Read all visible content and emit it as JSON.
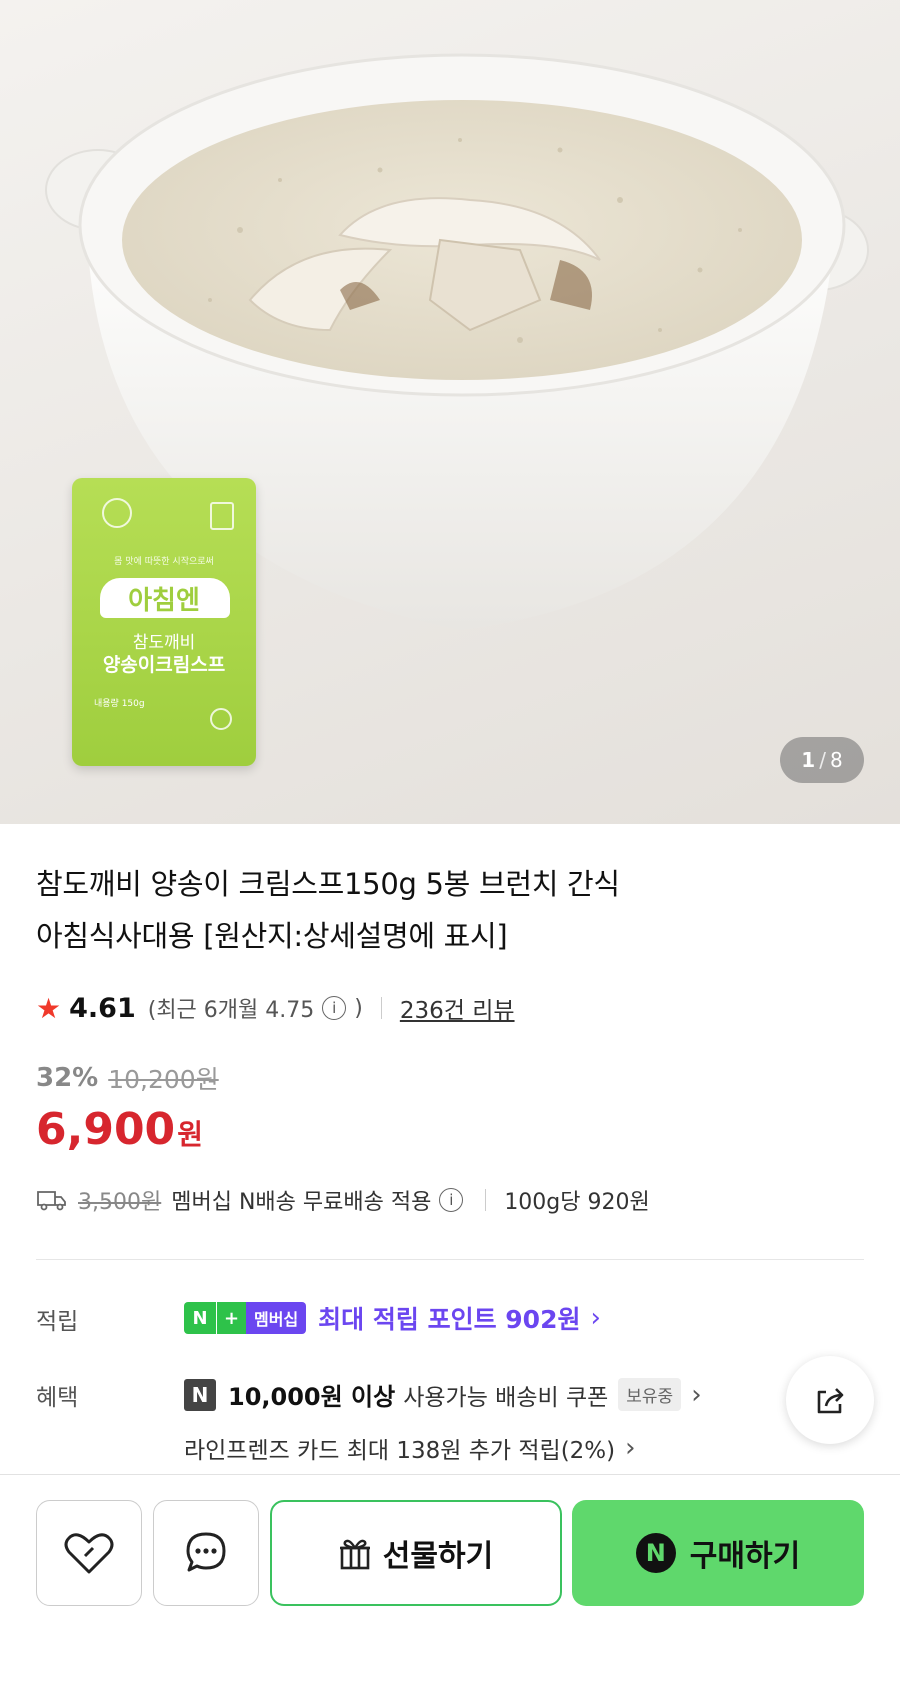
{
  "hero": {
    "image_index": "1",
    "image_separator": "/",
    "image_total": "8",
    "package": {
      "tagline": "몸 맛에 따뜻한 시작으로써",
      "brand": "아침엔",
      "line1": "참도깨비",
      "line2": "양송이크림스프",
      "weight_label": "내용량 150g"
    }
  },
  "product": {
    "title_line1": "참도깨비 양송이 크림스프150g 5봉 브런치 간식",
    "title_line2": "아침식사대용 [원산지:상세설명에 표시]",
    "rating": "4.61",
    "recent_rating_prefix": "(최근 6개월 4.75",
    "recent_rating_suffix": ")",
    "review_link": "236건 리뷰",
    "discount": "32%",
    "original_price": "10,200원",
    "price": "6,900",
    "price_unit": "원"
  },
  "shipping": {
    "original_fee": "3,500원",
    "text": "멤버십 N배송 무료배송 적용",
    "unit_price": "100g당 920원"
  },
  "benefits": {
    "points_label": "적립",
    "badge_n": "N",
    "badge_plus": "+",
    "badge_membership": "멤버십",
    "points_text": "최대 적립 포인트 902원",
    "benefit_label": "혜택",
    "coupon_badge": "N",
    "coupon_amount": "10,000원 이상",
    "coupon_text": "사용가능 배송비 쿠폰",
    "coupon_status": "보유중",
    "card_text": "라인프렌즈 카드 최대 138원 추가 적립(2%)"
  },
  "actions": {
    "gift_label": "선물하기",
    "buy_badge": "N",
    "buy_label": "구매하기"
  },
  "colors": {
    "price_red": "#d7262e",
    "membership_purple": "#6b46f0",
    "npay_green": "#5fd86c"
  },
  "icons": [
    "star-icon",
    "info-icon",
    "truck-icon",
    "chevron-right-icon",
    "share-icon",
    "heart-icon",
    "chat-icon",
    "gift-icon"
  ]
}
